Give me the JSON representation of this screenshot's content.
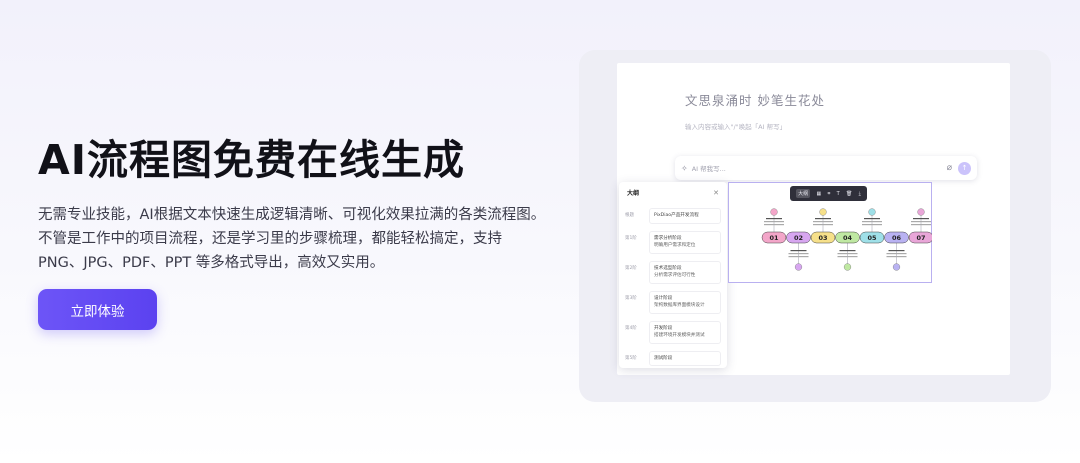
{
  "hero": {
    "title": "AI流程图免费在线生成",
    "description": "无需专业技能，AI根据文本快速生成逻辑清晰、可视化效果拉满的各类流程图。不管是工作中的项目流程，还是学习里的步骤梳理，都能轻松搞定，支持 PNG、JPG、PDF、PPT 等多格式导出，高效又实用。",
    "cta_label": "立即体验"
  },
  "preview": {
    "editor_title": "文思泉涌时 妙笔生花处",
    "editor_hint": "输入内容或输入\"/\"唤起「AI 帮写」",
    "ai_input_placeholder": "AI 帮我写...",
    "icons": {
      "spark": "sparkle-icon",
      "clip": "paperclip-icon",
      "send": "send-icon",
      "close": "close-icon"
    },
    "outline": {
      "title": "大纲",
      "items": [
        {
          "level": "根题",
          "title": "PixDiao产品开发流程",
          "sub": ""
        },
        {
          "level": "第1阶",
          "title": "需求分析阶段",
          "sub": "明确用户需求和定位"
        },
        {
          "level": "第2阶",
          "title": "技术选型阶段",
          "sub": "分析需求评估可行性"
        },
        {
          "level": "第3阶",
          "title": "设计阶段",
          "sub": "架构数据库界面模块设计"
        },
        {
          "level": "第4阶",
          "title": "开发阶段",
          "sub": "搭建环境开发模块并测试"
        },
        {
          "level": "第5阶",
          "title": "测试阶段",
          "sub": ""
        }
      ]
    },
    "toolbar": {
      "items": [
        "大纲",
        "▦",
        "⌗",
        "T",
        "🗑",
        "⤓"
      ]
    },
    "flow": {
      "steps": [
        "01",
        "02",
        "03",
        "04",
        "05",
        "06",
        "07"
      ],
      "colors": [
        "#f3a6c9",
        "#d7a6f0",
        "#f6e08a",
        "#bfe8a2",
        "#9fe0e8",
        "#b9b2f2",
        "#e9a6d8"
      ]
    }
  }
}
